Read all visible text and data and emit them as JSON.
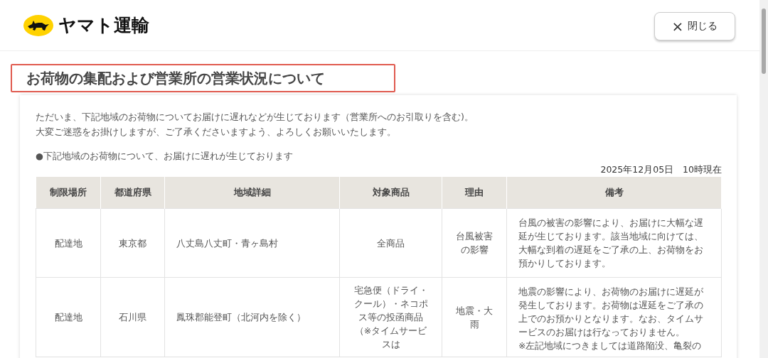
{
  "header": {
    "logo_text": "ヤマト運輸",
    "close_button": {
      "icon": "×",
      "label": "閉じる"
    }
  },
  "page_title": "お荷物の集配および営業所の営業状況について",
  "intro": [
    "ただいま、下記地域のお荷物についてお届けに遅れなどが生じております（営業所へのお引取りを含む)。",
    "大変ご迷惑をお掛けしますが、ご了承くださいますよう、よろしくお願いいたします。"
  ],
  "notice": "●下記地域のお荷物について、お届けに遅れが生じております",
  "as_of": "2025年12月05日　10時現在",
  "table": {
    "columns": [
      "制限場所",
      "都道府県",
      "地域詳細",
      "対象商品",
      "理由",
      "備考"
    ],
    "rows": [
      [
        "配達地",
        "東京都",
        "八丈島八丈町・青ヶ島村",
        "全商品",
        "台風被害の影響",
        "台風の被害の影響により、お届けに大幅な遅延が生じております。該当地域に向けては、大幅な到着の遅延をご了承の上、お荷物をお預かりしております。"
      ],
      [
        "配達地",
        "石川県",
        "鳳珠郡能登町（北河内を除く）",
        "宅急便（ドライ・クール）・ネコポス等の投函商品（※タイムサービスは",
        "地震・大雨",
        "地震の影響により、お荷物のお届けに遅延が発生しております。お荷物は遅延をご了承の上でのお預かりとなります。なお、タイムサービスのお届けは行なっておりません。\n※左記地域につきましては道路陥没、亀裂の"
      ]
    ]
  }
}
